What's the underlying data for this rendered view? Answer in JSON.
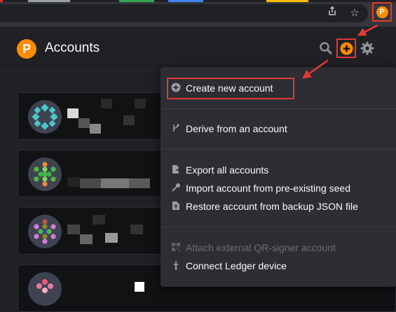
{
  "browser": {
    "toolbar_icons": [
      "share-icon",
      "star-icon"
    ],
    "extension_icon": "polkadot-extension-icon",
    "extension_glyph": "P"
  },
  "header": {
    "logo_glyph": "P",
    "title": "Accounts",
    "icons": [
      "search-icon",
      "add-account-icon",
      "settings-icon"
    ]
  },
  "menu": {
    "items": [
      {
        "label": "Create new account",
        "icon": "plus-circle-icon",
        "disabled": false
      },
      {
        "label": "Derive from an account",
        "icon": "branch-icon",
        "disabled": false
      },
      {
        "label": "Export all accounts",
        "icon": "export-icon",
        "disabled": false
      },
      {
        "label": "Import account from pre-existing seed",
        "icon": "key-icon",
        "disabled": false
      },
      {
        "label": "Restore account from backup JSON file",
        "icon": "file-upload-icon",
        "disabled": false
      },
      {
        "label": "Attach external QR-signer account",
        "icon": "qrcode-icon",
        "disabled": true
      },
      {
        "label": "Connect Ledger device",
        "icon": "usb-icon",
        "disabled": false
      }
    ]
  },
  "colors": {
    "accent": "#ff8c00",
    "highlight": "#e53935",
    "background": "#1f2125",
    "menu_bg": "#2c2e33"
  }
}
